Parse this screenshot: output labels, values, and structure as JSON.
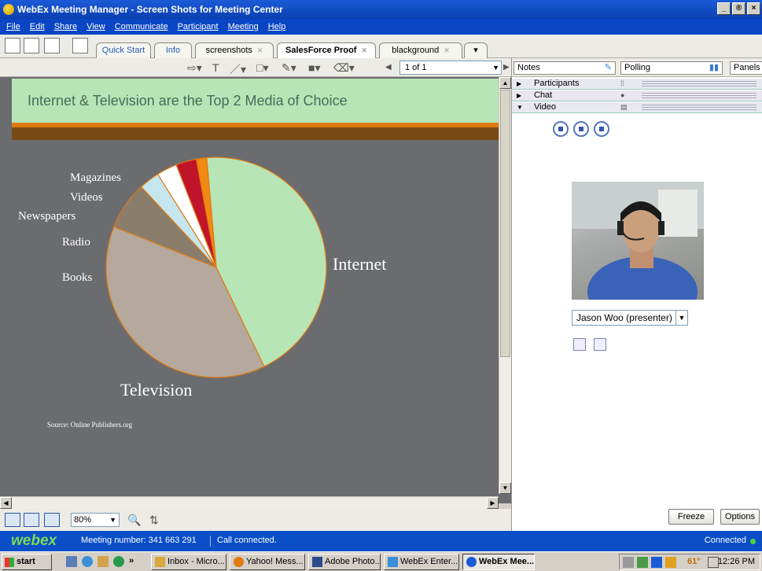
{
  "window": {
    "title": "WebEx Meeting Manager - Screen Shots for Meeting Center",
    "controls": [
      "_",
      "®",
      "×"
    ]
  },
  "menu": [
    "File",
    "Edit",
    "Share",
    "View",
    "Communicate",
    "Participant",
    "Meeting",
    "Help"
  ],
  "doc_tabs": [
    {
      "label": "Quick Start",
      "active": false,
      "closable": false
    },
    {
      "label": "Info",
      "active": false,
      "closable": false
    },
    {
      "label": "screenshots",
      "active": false,
      "closable": true
    },
    {
      "label": "SalesForce Proof",
      "active": true,
      "closable": true
    },
    {
      "label": "blackground",
      "active": false,
      "closable": true
    }
  ],
  "annotation": {
    "page_indicator": "1 of 1"
  },
  "slide": {
    "title": "Internet & Television are the Top 2 Media of Choice",
    "source": "Source: Online Publishers.org"
  },
  "chart_data": {
    "type": "pie",
    "title": "Internet & Television are the Top 2 Media of Choice",
    "labels": [
      "Internet",
      "Television",
      "Books",
      "Radio",
      "Newspapers",
      "Videos",
      "Magazines"
    ],
    "values": [
      44,
      38,
      7,
      3,
      3,
      3,
      1.5
    ],
    "colors": [
      "#b8e5b6",
      "#b4a99c",
      "#8b7d6c",
      "#c5e6ee",
      "#ffffff",
      "#c0142a",
      "#f08a12"
    ],
    "edge_color": "#e07a12"
  },
  "view": {
    "zoom": "80%"
  },
  "right_panel": {
    "notes_label": "Notes",
    "polling_label": "Polling",
    "panels_label": "Panels",
    "rows": [
      {
        "label": "Participants",
        "expanded": false
      },
      {
        "label": "Chat",
        "expanded": false
      },
      {
        "label": "Video",
        "expanded": true
      }
    ],
    "presenter": "Jason Woo (presenter)",
    "freeze_label": "Freeze",
    "options_label": "Options"
  },
  "status": {
    "logo": "webex",
    "meeting_number": "Meeting number: 341 663 291",
    "call_status": "Call connected.",
    "connection": "Connected"
  },
  "taskbar": {
    "start": "start",
    "quicklaunch_more": "»",
    "tasks": [
      {
        "label": "Inbox - Micro...",
        "active": false
      },
      {
        "label": "Yahoo! Mess...",
        "active": false
      },
      {
        "label": "Adobe Photo...",
        "active": false
      },
      {
        "label": "WebEx Enter...",
        "active": false
      },
      {
        "label": "WebEx Mee...",
        "active": true
      }
    ],
    "temperature": "61°",
    "time": "12:26 PM"
  }
}
